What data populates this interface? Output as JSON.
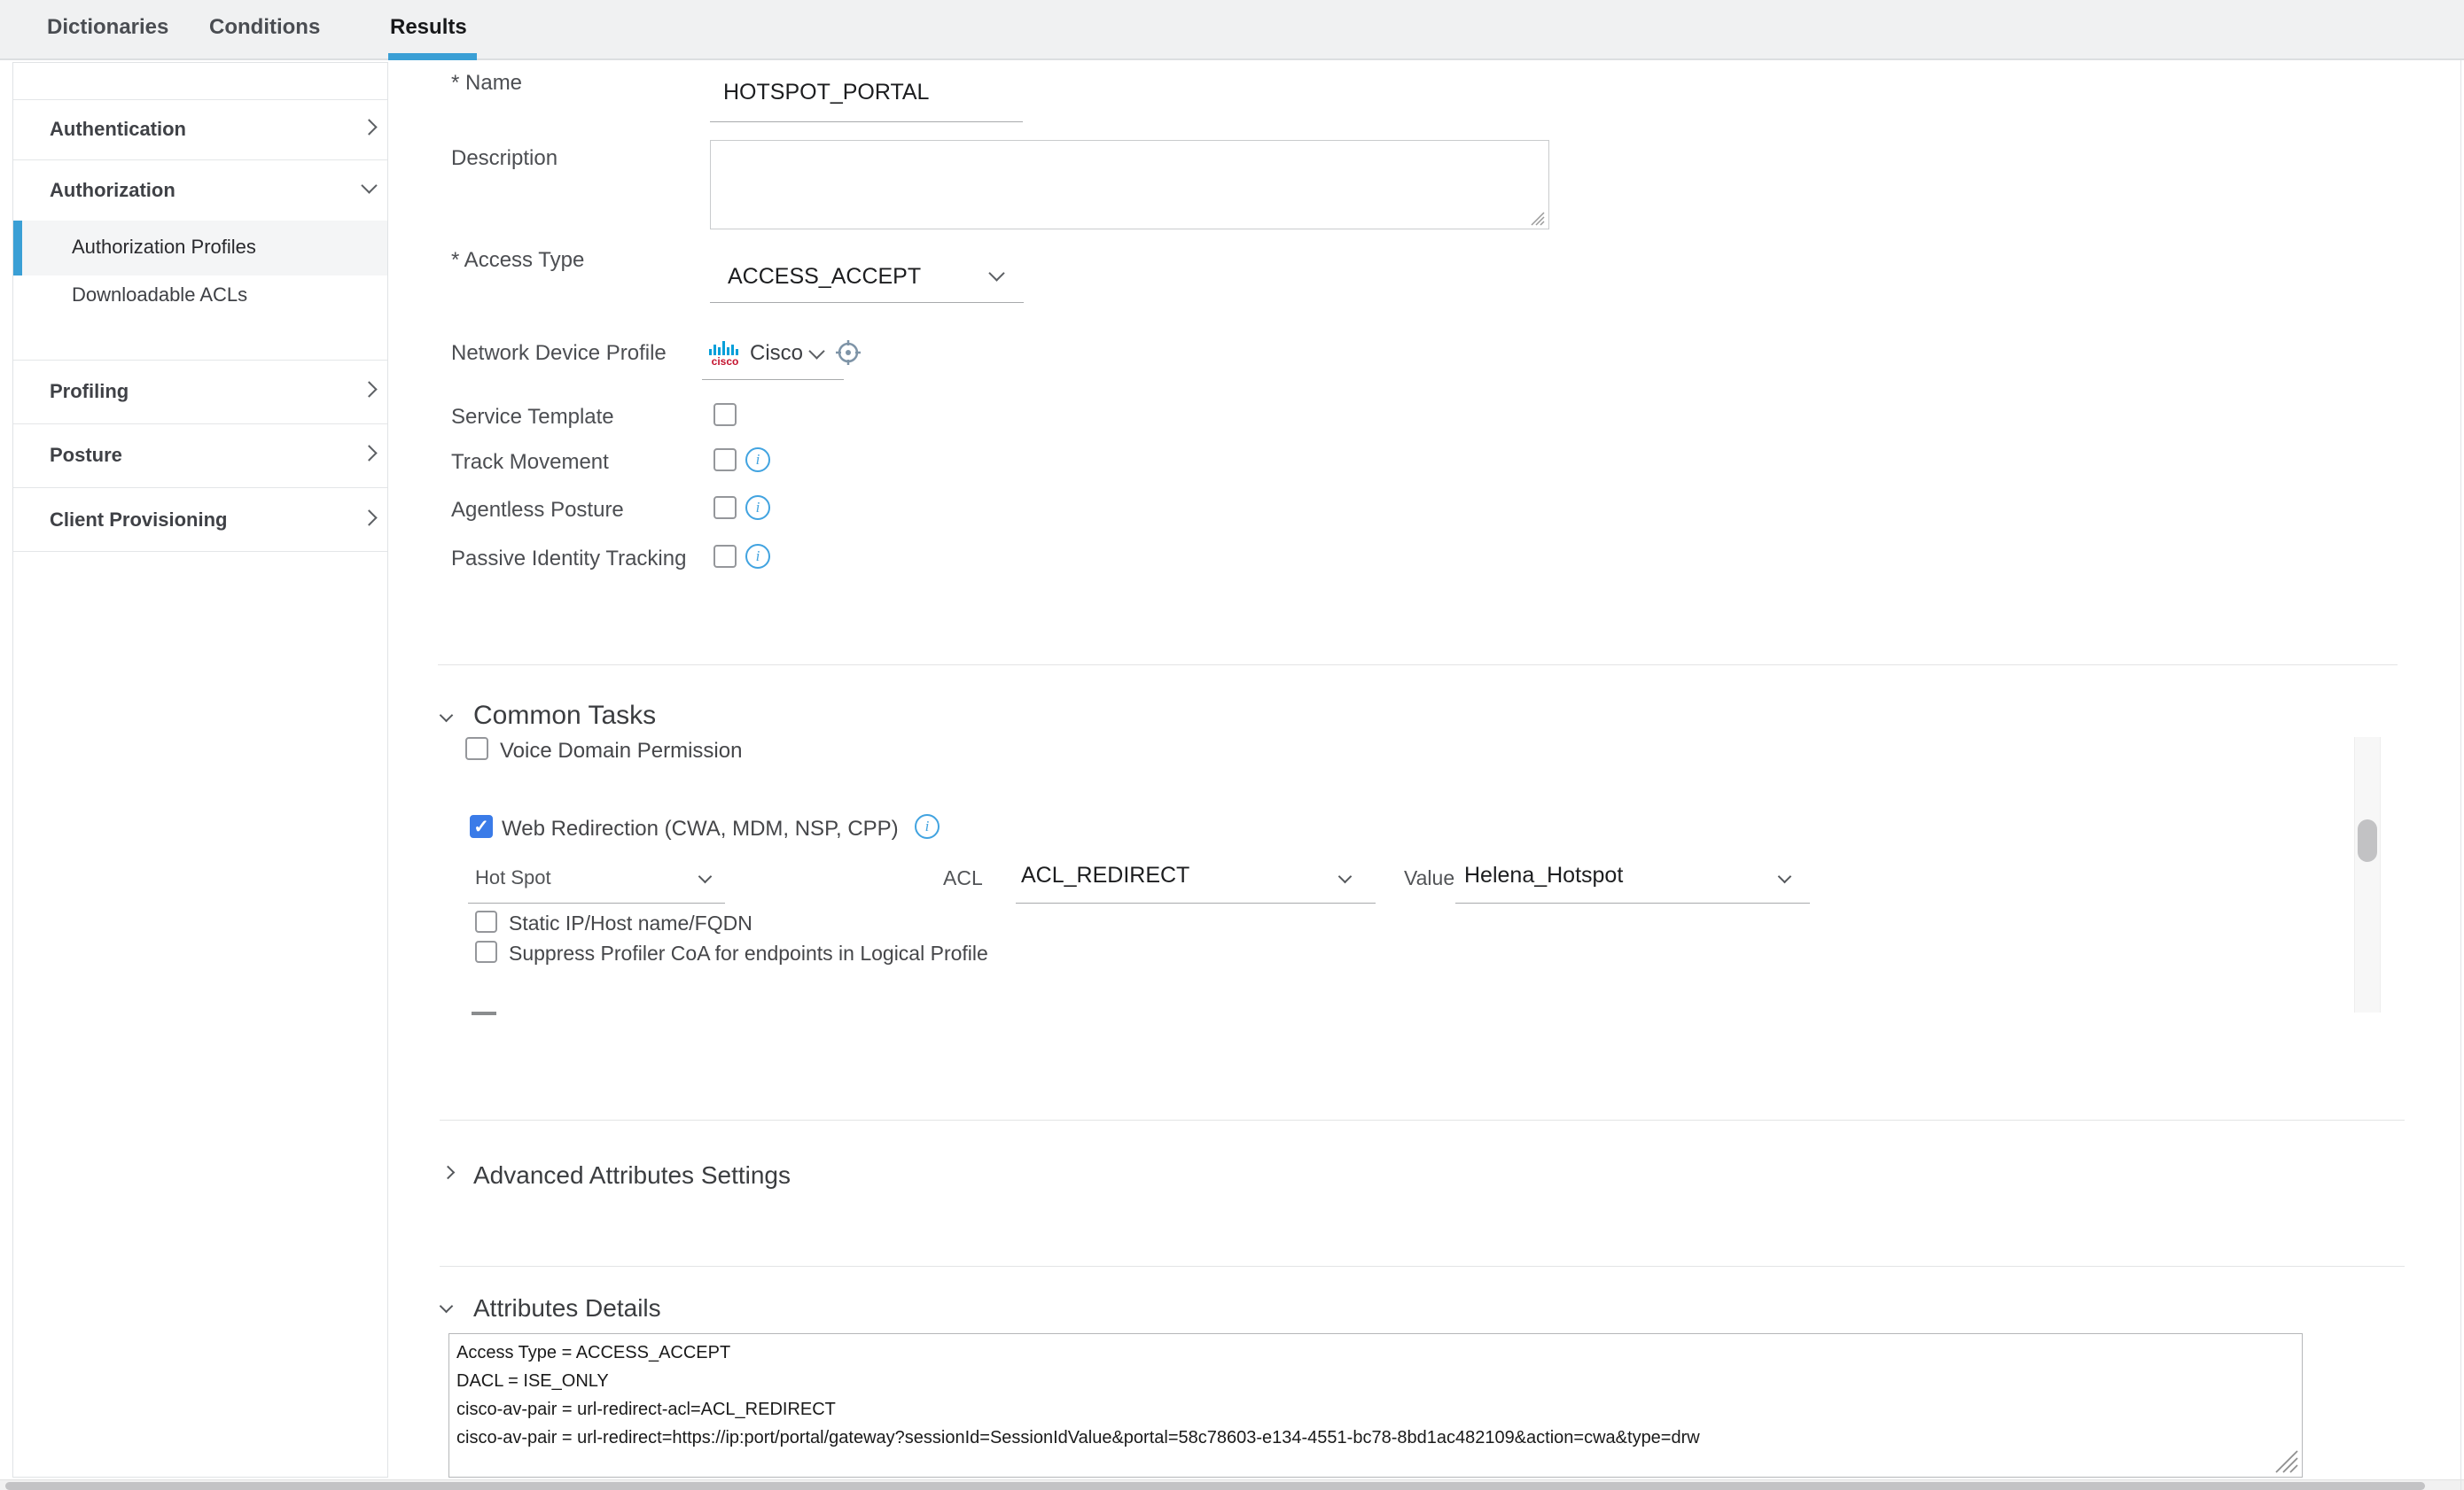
{
  "tabs": {
    "items": [
      {
        "label": "Dictionaries"
      },
      {
        "label": "Conditions"
      },
      {
        "label": "Results"
      }
    ],
    "active": "Results"
  },
  "colors": {
    "accent_blue": "#3a9fd5",
    "checkbox_blue": "#3a7be8",
    "info_blue": "#41a3e0",
    "cisco_red": "#c4122e",
    "cisco_bar_blue": "#049fd9"
  },
  "sidebar": {
    "authentication": {
      "label": "Authentication"
    },
    "authorization": {
      "label": "Authorization"
    },
    "authorization_profiles": {
      "label": "Authorization Profiles",
      "selected": true
    },
    "downloadable_acls": {
      "label": "Downloadable ACLs"
    },
    "profiling": {
      "label": "Profiling"
    },
    "posture": {
      "label": "Posture"
    },
    "client_provisioning": {
      "label": "Client Provisioning"
    }
  },
  "form": {
    "name_label": "* Name",
    "name_value": "HOTSPOT_PORTAL",
    "description_label": "Description",
    "description_value": "",
    "access_type_label": "* Access Type",
    "access_type_value": "ACCESS_ACCEPT",
    "ndp_label": "Network Device Profile",
    "ndp_value": "Cisco",
    "ndp_logo_text": "cisco",
    "service_template_label": "Service Template",
    "track_movement_label": "Track Movement",
    "agentless_posture_label": "Agentless Posture",
    "passive_identity_label": "Passive Identity Tracking"
  },
  "common_tasks": {
    "title": "Common Tasks",
    "voice_domain_label": "Voice Domain Permission",
    "web_redirection_label": "Web Redirection (CWA, MDM, NSP, CPP)",
    "web_redirection_checked": true,
    "check_glyph": "✓",
    "redirect_type_value": "Hot Spot",
    "acl_label": "ACL",
    "acl_value": "ACL_REDIRECT",
    "value_label": "Value",
    "value_value": "Helena_Hotspot",
    "static_ip_label": "Static IP/Host name/FQDN",
    "suppress_profiler_label": "Suppress Profiler CoA for endpoints in Logical Profile"
  },
  "advanced_attributes": {
    "title": "Advanced Attributes Settings"
  },
  "attributes_details": {
    "title": "Attributes Details",
    "lines": [
      "Access Type = ACCESS_ACCEPT",
      "DACL = ISE_ONLY",
      "cisco-av-pair = url-redirect-acl=ACL_REDIRECT",
      "cisco-av-pair = url-redirect=https://ip:port/portal/gateway?sessionId=SessionIdValue&portal=58c78603-e134-4551-bc78-8bd1ac482109&action=cwa&type=drw"
    ],
    "info_i": "i"
  }
}
